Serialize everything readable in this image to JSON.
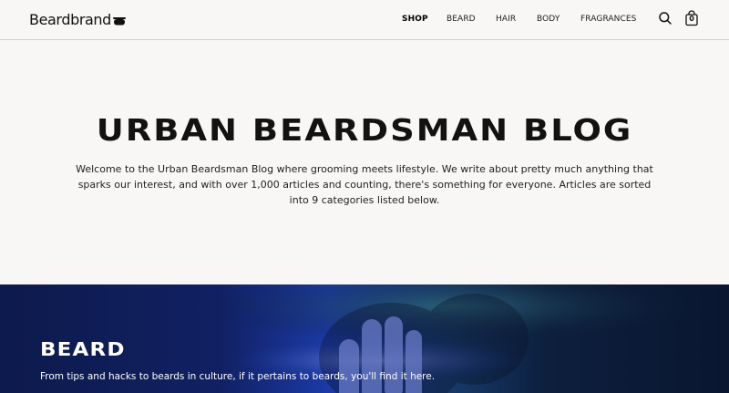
{
  "header": {
    "logo": "Beardbrand",
    "nav": [
      {
        "label": "SHOP",
        "active": true
      },
      {
        "label": "BEARD",
        "active": false
      },
      {
        "label": "HAIR",
        "active": false
      },
      {
        "label": "BODY",
        "active": false
      },
      {
        "label": "FRAGRANCES",
        "active": false
      }
    ],
    "icons": [
      "search-icon",
      "cart-icon"
    ],
    "cart_count": "0"
  },
  "intro": {
    "title": "URBAN BEARDSMAN BLOG",
    "description": "Welcome to the Urban Beardsman Blog where grooming meets lifestyle. We write about pretty much anything that sparks our interest, and with over 1,000 articles and counting, there's something for everyone. Articles are sorted into 9 categories listed below."
  },
  "category_banner": {
    "title": "BEARD",
    "description": "From tips and hacks to beards in culture, if it pertains to beards, you'll find it here."
  },
  "colors": {
    "page_bg": "#f8f7f5",
    "banner_bg": "#0e1a4a",
    "text": "#111111"
  }
}
